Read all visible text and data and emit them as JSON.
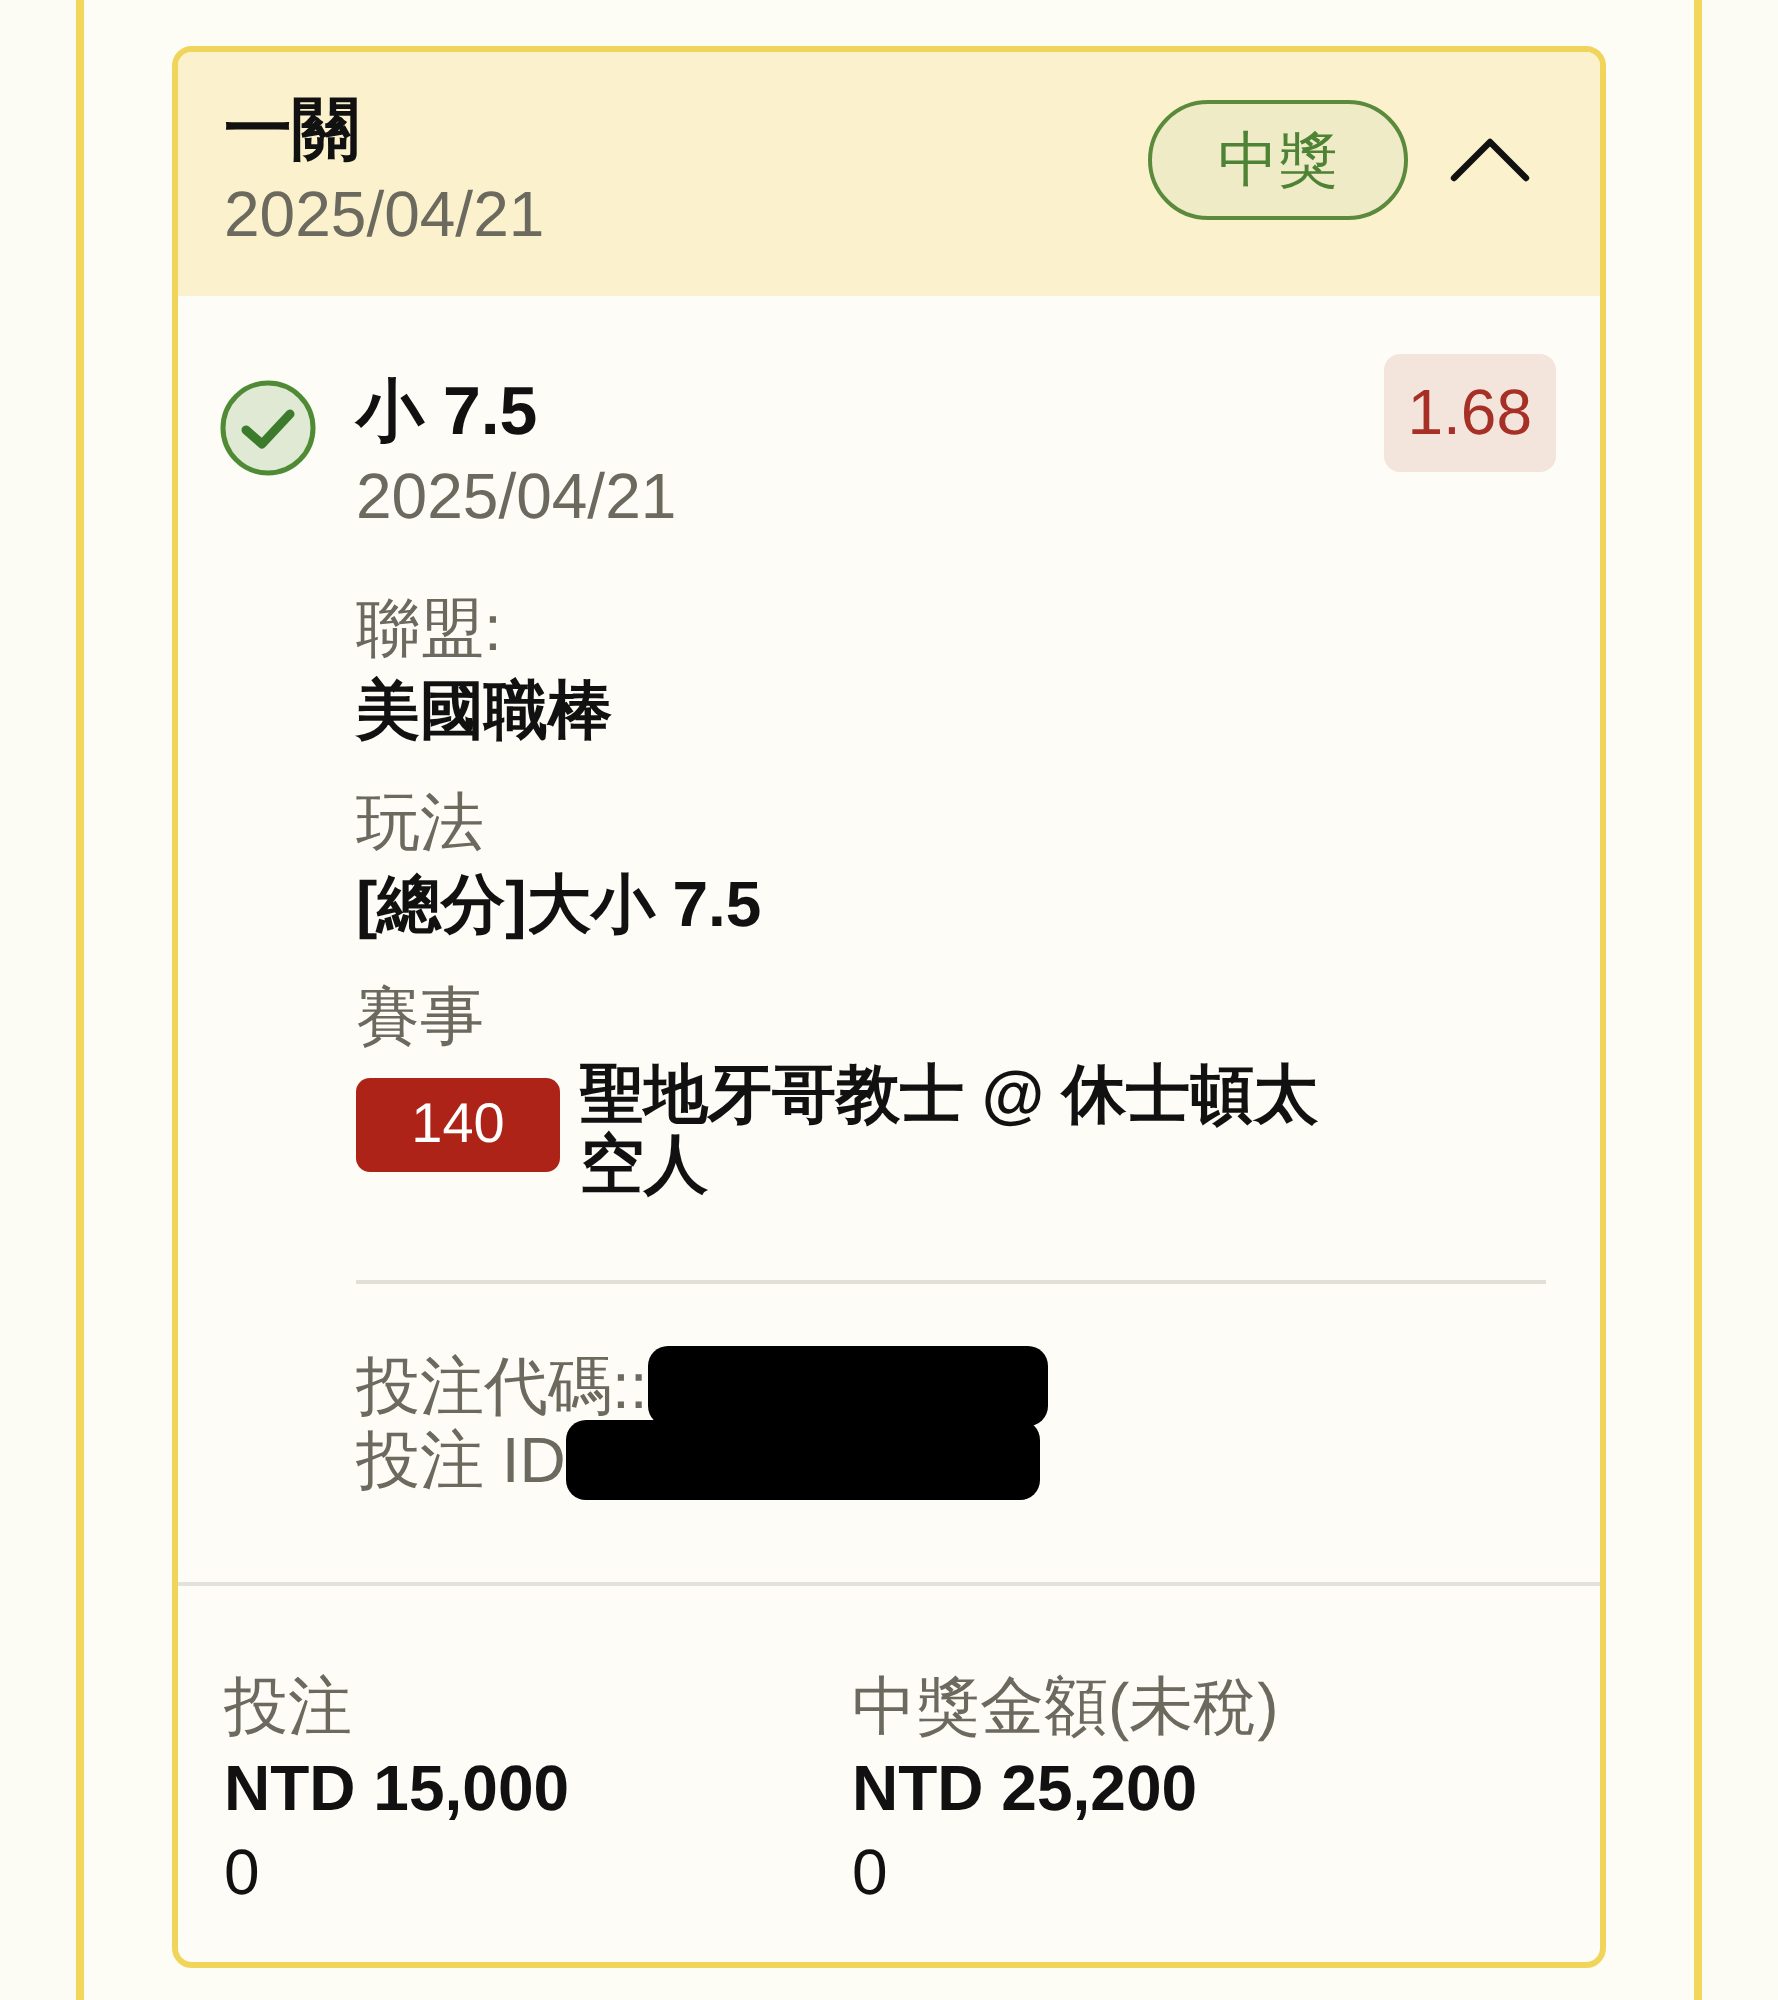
{
  "ticket": {
    "title": "一關",
    "date": "2025/04/21",
    "status_badge": "中獎",
    "expanded": true
  },
  "selection": {
    "won": true,
    "pick": "小 7.5",
    "date": "2025/04/21",
    "odds": "1.68",
    "fields": [
      {
        "label": "聯盟:",
        "value": "美國職棒"
      },
      {
        "label": "玩法",
        "value": "[總分]大小 7.5"
      }
    ],
    "event": {
      "label": "賽事",
      "number": "140",
      "name": "聖地牙哥教士 @ 休士頓太空人"
    },
    "codes": [
      {
        "label": "投注代碼::",
        "redacted": true
      },
      {
        "label": "投注 ID",
        "redacted": true
      }
    ]
  },
  "summary": [
    {
      "label": "投注",
      "amount": "NTD 15,000",
      "value": "0"
    },
    {
      "label": "中獎金額(未稅)",
      "amount": "NTD 25,200",
      "value": "0"
    }
  ]
}
